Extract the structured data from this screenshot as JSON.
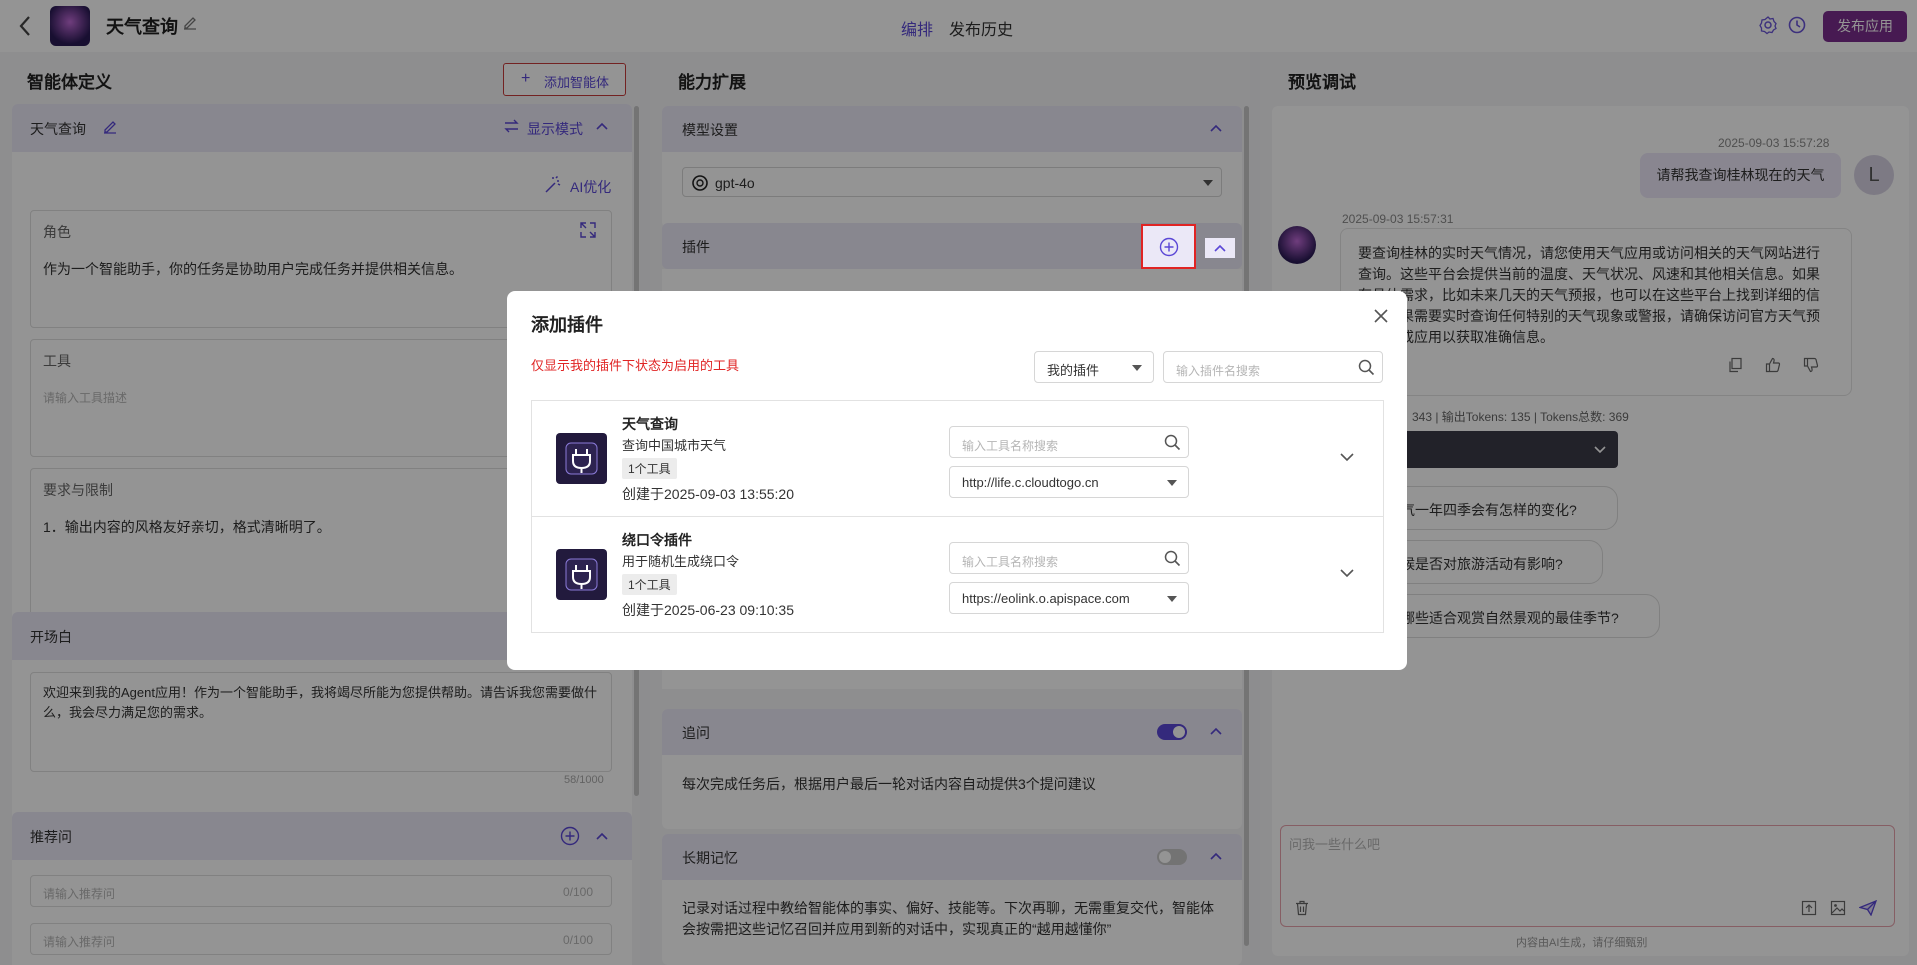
{
  "app": {
    "title": "天气查询",
    "tabs": [
      "编排",
      "发布历史"
    ],
    "publish_label": "发布应用"
  },
  "left": {
    "section_title": "智能体定义",
    "add_agent_label": "添加智能体",
    "agent_name": "天气查询",
    "display_mode_label": "显示模式",
    "ai_optimize_label": "AI优化",
    "role": {
      "label": "角色",
      "value": "作为一个智能助手，你的任务是协助用户完成任务并提供相关信息。"
    },
    "tools": {
      "label": "工具",
      "placeholder": "请输入工具描述"
    },
    "requirements": {
      "label": "要求与限制",
      "value": "1．输出内容的风格友好亲切，格式清晰明了。"
    },
    "opening": {
      "label": "开场白",
      "value": "欢迎来到我的Agent应用！作为一个智能助手，我将竭尽所能为您提供帮助。请告诉我您需要做什么，我会尽力满足您的需求。",
      "counter": "58/1000"
    },
    "recommend": {
      "label": "推荐问",
      "items": [
        {
          "placeholder": "请输入推荐问",
          "counter": "0/100"
        },
        {
          "placeholder": "请输入推荐问",
          "counter": "0/100"
        }
      ]
    }
  },
  "middle": {
    "section_title": "能力扩展",
    "model": {
      "label": "模型设置",
      "value": "gpt-4o"
    },
    "plugins_label": "插件",
    "followup": {
      "label": "追问",
      "desc": "每次完成任务后，根据用户最后一轮对话内容自动提供3个提问建议",
      "enabled": true
    },
    "memory": {
      "label": "长期记忆",
      "desc": "记录对话过程中教给智能体的事实、偏好、技能等。下次再聊，无需重复交代，智能体会按需把这些记忆召回并应用到新的对话中，实现真正的“越用越懂你”",
      "enabled": false
    }
  },
  "right": {
    "section_title": "预览调试",
    "user_msg": {
      "time": "2025-09-03 15:57:28",
      "text": "请帮我查询桂林现在的天气",
      "avatar": "L"
    },
    "bot_msg": {
      "time": "2025-09-03 15:57:31",
      "lines": [
        "要查询桂林的实时天气情况，请您使用天气应用或访问相关的天气网站进行",
        "查询。这些平台会提供当前的温度、天气状况、风速和其他相关信息。如果",
        "有具体需求，比如未来几天的天气预报，也可以在这些平台上找到详细的信",
        "息。如果需要实时查询任何特别的天气现象或警报，请确保访问官方天气预",
        "报网站或应用以获取准确信息。"
      ]
    },
    "token_stats": "343 | 输出Tokens: 135 | Tokens总数: 369",
    "suggestions": [
      "桂林天气一年四季会有怎样的变化?",
      "桂林气候是否对旅游活动有影响?",
      "桂林有哪些适合观赏自然景观的最佳季节?"
    ],
    "input_placeholder": "问我一些什么吧",
    "footer_note": "内容由AI生成，请仔细甄别"
  },
  "modal": {
    "title": "添加插件",
    "notice": "仅显示我的插件下状态为启用的工具",
    "filter_value": "我的插件",
    "search_placeholder": "输入插件名搜索",
    "plugins": [
      {
        "name": "天气查询",
        "desc": "查询中国城市天气",
        "tag": "1个工具",
        "created": "创建于2025-09-03 13:55:20",
        "tool_search_placeholder": "输入工具名称搜索",
        "url": "http://life.c.cloudtogo.cn"
      },
      {
        "name": "绕口令插件",
        "desc": "用于随机生成绕口令",
        "tag": "1个工具",
        "created": "创建于2025-06-23 09:10:35",
        "tool_search_placeholder": "输入工具名称搜索",
        "url": "https://eolink.o.apispace.com"
      }
    ]
  },
  "colors": {
    "accent": "#5b47d6",
    "publish_bg": "#7b2d8e",
    "notice": "#e02424",
    "highlight_border": "#e02424"
  }
}
